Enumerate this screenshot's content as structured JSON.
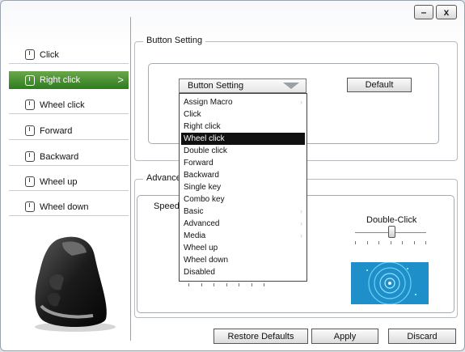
{
  "window": {
    "minimize_label": "–",
    "close_label": "x"
  },
  "sidebar": {
    "items": [
      {
        "label": "Click",
        "icon": "mouse-button-icon",
        "active": false
      },
      {
        "label": "Right click",
        "icon": "mouse-button-icon",
        "active": true
      },
      {
        "label": "Wheel click",
        "icon": "mouse-button-icon",
        "active": false
      },
      {
        "label": "Forward",
        "icon": "mouse-button-icon",
        "active": false
      },
      {
        "label": "Backward",
        "icon": "mouse-button-icon",
        "active": false
      },
      {
        "label": "Wheel up",
        "icon": "mouse-button-icon",
        "active": false
      },
      {
        "label": "Wheel down",
        "icon": "mouse-button-icon",
        "active": false
      }
    ],
    "active_chevron": ">"
  },
  "button_setting": {
    "group_title": "Button Setting",
    "combo_value": "Button Setting",
    "default_button": "Default"
  },
  "dropdown": {
    "items": [
      {
        "label": "Assign Macro",
        "submenu": true,
        "selected": false
      },
      {
        "label": "Click",
        "submenu": false,
        "selected": false
      },
      {
        "label": "Right click",
        "submenu": false,
        "selected": false
      },
      {
        "label": "Wheel click",
        "submenu": false,
        "selected": true
      },
      {
        "label": "Double click",
        "submenu": false,
        "selected": false
      },
      {
        "label": "Forward",
        "submenu": false,
        "selected": false
      },
      {
        "label": "Backward",
        "submenu": false,
        "selected": false
      },
      {
        "label": "Single key",
        "submenu": false,
        "selected": false
      },
      {
        "label": "Combo key",
        "submenu": false,
        "selected": false
      },
      {
        "label": "Basic",
        "submenu": true,
        "selected": false
      },
      {
        "label": "Advanced",
        "submenu": true,
        "selected": false
      },
      {
        "label": "Media",
        "submenu": true,
        "selected": false
      },
      {
        "label": "Wheel up",
        "submenu": false,
        "selected": false
      },
      {
        "label": "Wheel down",
        "submenu": false,
        "selected": false
      },
      {
        "label": "Disabled",
        "submenu": false,
        "selected": false
      }
    ],
    "submenu_arrow": "›"
  },
  "advanced": {
    "group_title": "Advance",
    "speed_label": "Speed",
    "double_click_label": "Double-Click",
    "double_click_level": 0.5
  },
  "footer": {
    "restore_defaults": "Restore Defaults",
    "apply": "Apply",
    "discard": "Discard"
  },
  "colors": {
    "active_item": "#3f8a2c",
    "preview_blue": "#1e8fc8"
  }
}
